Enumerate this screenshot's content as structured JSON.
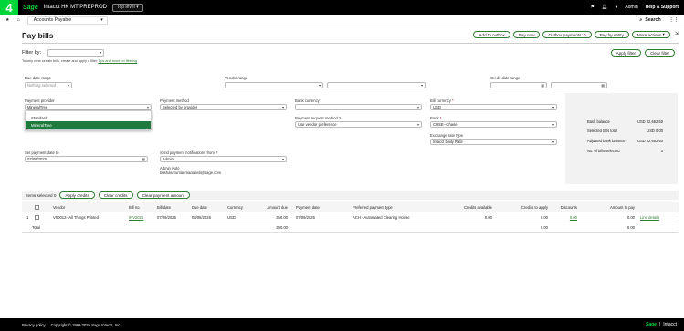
{
  "topbar": {
    "brand_char": "4",
    "logo": "Sage",
    "company": "Intacct  HK MT PREPROD",
    "env": "Top level",
    "user": "Admin",
    "help": "Help & Support"
  },
  "nav": {
    "module": "Accounts Payable",
    "search": "Search"
  },
  "page": {
    "title": "Pay bills"
  },
  "actions": [
    "Add to outbox",
    "Pay now",
    "Outbox payments: 0",
    "Pay by entity",
    "More actions"
  ],
  "filter": {
    "label": "Filter by:",
    "help_prefix": "To only view certain bills, create and apply a filter",
    "help_link": "Tips and more on filtering",
    "apply": "Apply filter",
    "clear": "Clear filter"
  },
  "fields": {
    "due_date_range": "Due date range",
    "due_date_value": "Nothing selected",
    "vendor_range": "Vendor range",
    "credit_date_range": "Credit date range",
    "payment_provider": "Payment provider",
    "payment_provider_value": "MineralTree",
    "payment_method": "Payment method",
    "payment_method_value": "Selected by provider",
    "bank_currency": "Bank currency",
    "bill_currency": "Bill currency",
    "bill_currency_value": "USD",
    "payment_request_method": "Payment request method",
    "payment_request_method_value": "Use vendor preference",
    "bank": "Bank",
    "bank_value": "CHSE--Chase",
    "exchange_rate_type": "Exchange rate type",
    "exchange_rate_value": "Intacct Daily Rate",
    "set_payment_date": "Set payment date to",
    "set_payment_date_value": "07/09/2025",
    "send_notifications": "Send payment notifications from",
    "send_notifications_value": "Admin",
    "admin_name": "Admin Auto",
    "admin_email": "bushasrkumar.madapati@sage.com"
  },
  "dropdown": {
    "options": [
      "Standard",
      "MineralTree"
    ]
  },
  "summary": [
    {
      "label": "Bank balance",
      "value": "USD 82,662.50"
    },
    {
      "label": "Selected bills total",
      "value": "USD 0.00"
    },
    {
      "label": "Adjusted bank balance",
      "value": "USD 82,662.50"
    },
    {
      "label": "No. of bills selected",
      "value": "0"
    }
  ],
  "items": {
    "selected": "Items selected 0",
    "buttons": [
      "Apply credits",
      "Clear credits",
      "Clear payment amount"
    ]
  },
  "table": {
    "headers": [
      "Vendor",
      "Bill no.",
      "Bill date",
      "Due date",
      "Currency",
      "Amount due",
      "Payment date",
      "Preferred payment type",
      "Credits available",
      "Credits to apply",
      "Discounts",
      "Amount to pay"
    ],
    "row": {
      "num": "1",
      "vendor": "V00012--All Things Printed",
      "bill_no": "INV2021",
      "bill_date": "07/09/2025",
      "due_date": "08/08/2025",
      "currency": "USD",
      "amount_due": "350.00",
      "payment_date": "07/09/2025",
      "payment_type": "ACH - Automated Clearing House",
      "credits_available": "0.00",
      "credits_to_apply": "0.00",
      "discounts": "0.00",
      "amount_to_pay": "0.00",
      "line_details": "Line details"
    },
    "total": {
      "label": "Total",
      "amount_due": "350.00",
      "credits_to_apply": "0.00",
      "amount_to_pay": "0.00"
    }
  },
  "footer": {
    "privacy": "Privacy policy",
    "copyright": "Copyright © 1999-2025 Sage Intacct, Inc.",
    "logo": "Sage",
    "product": "Intacct"
  },
  "colors": {
    "accent": "#00d639",
    "green_dark": "#1f7a3e"
  }
}
